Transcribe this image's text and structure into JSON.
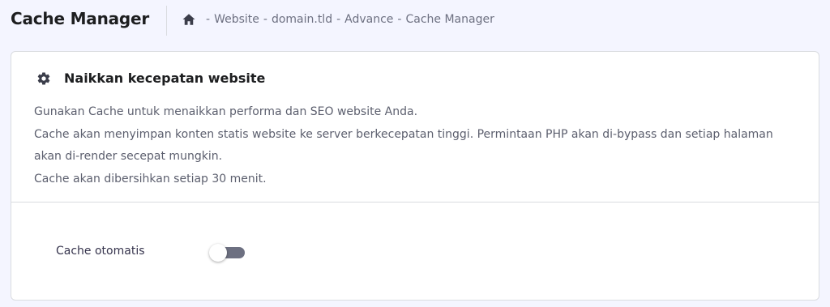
{
  "header": {
    "title": "Cache Manager"
  },
  "breadcrumb": {
    "home_icon": "home-icon",
    "separator": "-",
    "items": [
      "Website",
      "domain.tld",
      "Advance",
      "Cache Manager"
    ]
  },
  "card": {
    "icon": "gear-icon",
    "title": "Naikkan kecepatan website",
    "description": [
      "Gunakan Cache untuk menaikkan performa dan SEO website Anda.",
      "Cache akan menyimpan konten statis website ke server berkecepatan tinggi. Permintaan PHP akan di-bypass dan setiap halaman akan di-render secepat mungkin.",
      "Cache akan dibersihkan setiap 30 menit."
    ]
  },
  "settings": {
    "auto_cache": {
      "label": "Cache otomatis",
      "enabled": false
    }
  },
  "colors": {
    "background": "#f4f5ff",
    "card": "#ffffff",
    "border": "#dadce0",
    "toggle_off": "#6d7081"
  }
}
